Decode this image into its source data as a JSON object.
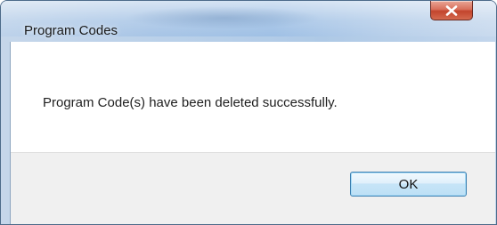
{
  "dialog": {
    "title": "Program Codes",
    "close_icon": "close-icon",
    "message": "Program Code(s) have been deleted successfully.",
    "ok_label": "OK"
  },
  "colors": {
    "close_button": "#c2452d",
    "ok_button_border": "#3c7fb1",
    "footer_background": "#f0f0f0"
  }
}
